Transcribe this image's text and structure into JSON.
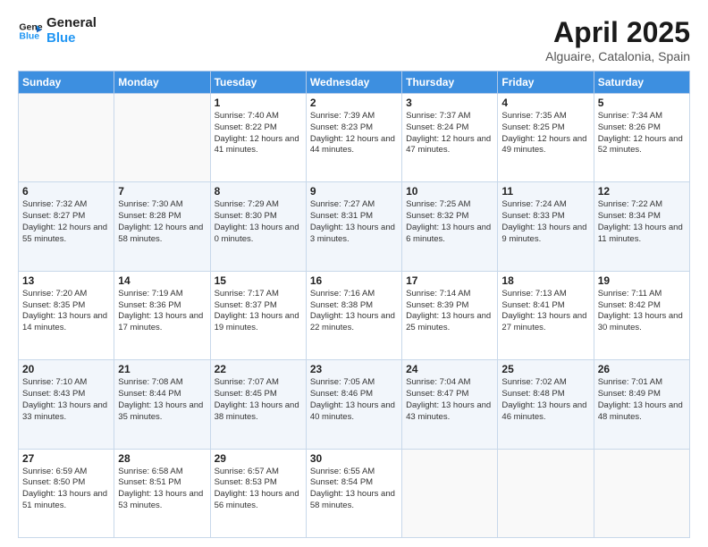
{
  "header": {
    "logo_line1": "General",
    "logo_line2": "Blue",
    "title": "April 2025",
    "subtitle": "Alguaire, Catalonia, Spain"
  },
  "days_of_week": [
    "Sunday",
    "Monday",
    "Tuesday",
    "Wednesday",
    "Thursday",
    "Friday",
    "Saturday"
  ],
  "weeks": [
    [
      {
        "day": "",
        "info": ""
      },
      {
        "day": "",
        "info": ""
      },
      {
        "day": "1",
        "info": "Sunrise: 7:40 AM\nSunset: 8:22 PM\nDaylight: 12 hours and 41 minutes."
      },
      {
        "day": "2",
        "info": "Sunrise: 7:39 AM\nSunset: 8:23 PM\nDaylight: 12 hours and 44 minutes."
      },
      {
        "day": "3",
        "info": "Sunrise: 7:37 AM\nSunset: 8:24 PM\nDaylight: 12 hours and 47 minutes."
      },
      {
        "day": "4",
        "info": "Sunrise: 7:35 AM\nSunset: 8:25 PM\nDaylight: 12 hours and 49 minutes."
      },
      {
        "day": "5",
        "info": "Sunrise: 7:34 AM\nSunset: 8:26 PM\nDaylight: 12 hours and 52 minutes."
      }
    ],
    [
      {
        "day": "6",
        "info": "Sunrise: 7:32 AM\nSunset: 8:27 PM\nDaylight: 12 hours and 55 minutes."
      },
      {
        "day": "7",
        "info": "Sunrise: 7:30 AM\nSunset: 8:28 PM\nDaylight: 12 hours and 58 minutes."
      },
      {
        "day": "8",
        "info": "Sunrise: 7:29 AM\nSunset: 8:30 PM\nDaylight: 13 hours and 0 minutes."
      },
      {
        "day": "9",
        "info": "Sunrise: 7:27 AM\nSunset: 8:31 PM\nDaylight: 13 hours and 3 minutes."
      },
      {
        "day": "10",
        "info": "Sunrise: 7:25 AM\nSunset: 8:32 PM\nDaylight: 13 hours and 6 minutes."
      },
      {
        "day": "11",
        "info": "Sunrise: 7:24 AM\nSunset: 8:33 PM\nDaylight: 13 hours and 9 minutes."
      },
      {
        "day": "12",
        "info": "Sunrise: 7:22 AM\nSunset: 8:34 PM\nDaylight: 13 hours and 11 minutes."
      }
    ],
    [
      {
        "day": "13",
        "info": "Sunrise: 7:20 AM\nSunset: 8:35 PM\nDaylight: 13 hours and 14 minutes."
      },
      {
        "day": "14",
        "info": "Sunrise: 7:19 AM\nSunset: 8:36 PM\nDaylight: 13 hours and 17 minutes."
      },
      {
        "day": "15",
        "info": "Sunrise: 7:17 AM\nSunset: 8:37 PM\nDaylight: 13 hours and 19 minutes."
      },
      {
        "day": "16",
        "info": "Sunrise: 7:16 AM\nSunset: 8:38 PM\nDaylight: 13 hours and 22 minutes."
      },
      {
        "day": "17",
        "info": "Sunrise: 7:14 AM\nSunset: 8:39 PM\nDaylight: 13 hours and 25 minutes."
      },
      {
        "day": "18",
        "info": "Sunrise: 7:13 AM\nSunset: 8:41 PM\nDaylight: 13 hours and 27 minutes."
      },
      {
        "day": "19",
        "info": "Sunrise: 7:11 AM\nSunset: 8:42 PM\nDaylight: 13 hours and 30 minutes."
      }
    ],
    [
      {
        "day": "20",
        "info": "Sunrise: 7:10 AM\nSunset: 8:43 PM\nDaylight: 13 hours and 33 minutes."
      },
      {
        "day": "21",
        "info": "Sunrise: 7:08 AM\nSunset: 8:44 PM\nDaylight: 13 hours and 35 minutes."
      },
      {
        "day": "22",
        "info": "Sunrise: 7:07 AM\nSunset: 8:45 PM\nDaylight: 13 hours and 38 minutes."
      },
      {
        "day": "23",
        "info": "Sunrise: 7:05 AM\nSunset: 8:46 PM\nDaylight: 13 hours and 40 minutes."
      },
      {
        "day": "24",
        "info": "Sunrise: 7:04 AM\nSunset: 8:47 PM\nDaylight: 13 hours and 43 minutes."
      },
      {
        "day": "25",
        "info": "Sunrise: 7:02 AM\nSunset: 8:48 PM\nDaylight: 13 hours and 46 minutes."
      },
      {
        "day": "26",
        "info": "Sunrise: 7:01 AM\nSunset: 8:49 PM\nDaylight: 13 hours and 48 minutes."
      }
    ],
    [
      {
        "day": "27",
        "info": "Sunrise: 6:59 AM\nSunset: 8:50 PM\nDaylight: 13 hours and 51 minutes."
      },
      {
        "day": "28",
        "info": "Sunrise: 6:58 AM\nSunset: 8:51 PM\nDaylight: 13 hours and 53 minutes."
      },
      {
        "day": "29",
        "info": "Sunrise: 6:57 AM\nSunset: 8:53 PM\nDaylight: 13 hours and 56 minutes."
      },
      {
        "day": "30",
        "info": "Sunrise: 6:55 AM\nSunset: 8:54 PM\nDaylight: 13 hours and 58 minutes."
      },
      {
        "day": "",
        "info": ""
      },
      {
        "day": "",
        "info": ""
      },
      {
        "day": "",
        "info": ""
      }
    ]
  ]
}
